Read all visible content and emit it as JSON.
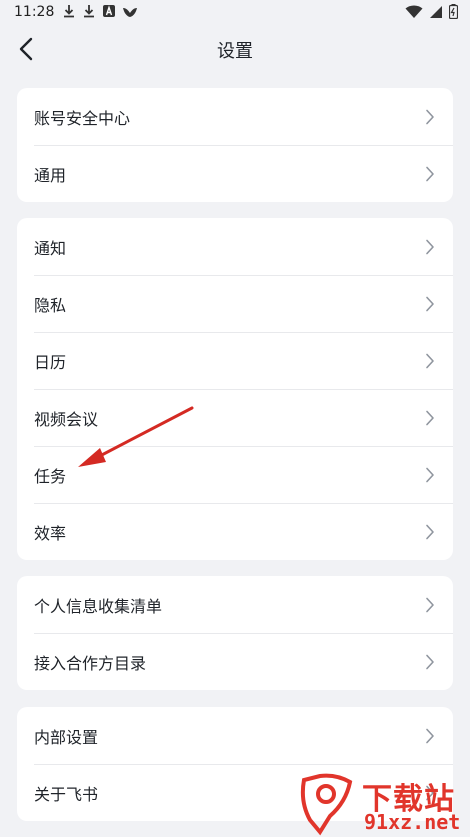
{
  "status_bar": {
    "time": "11:28",
    "left_icons": [
      "download-icon",
      "download-icon",
      "a-badge-icon",
      "bird-icon"
    ],
    "right_icons": [
      "wifi-icon",
      "signal-icon",
      "battery-icon"
    ]
  },
  "header": {
    "title": "设置"
  },
  "groups": [
    {
      "items": [
        {
          "label": "账号安全中心"
        },
        {
          "label": "通用"
        }
      ]
    },
    {
      "items": [
        {
          "label": "通知"
        },
        {
          "label": "隐私"
        },
        {
          "label": "日历"
        },
        {
          "label": "视频会议"
        },
        {
          "label": "任务"
        },
        {
          "label": "效率"
        }
      ]
    },
    {
      "items": [
        {
          "label": "个人信息收集清单"
        },
        {
          "label": "接入合作方目录"
        }
      ]
    },
    {
      "items": [
        {
          "label": "内部设置"
        },
        {
          "label": "关于飞书"
        }
      ]
    }
  ],
  "watermark": {
    "text_cn": "下载站",
    "text_url": "91xz.net"
  },
  "colors": {
    "background": "#f1f2f5",
    "card": "#ffffff",
    "annotation_arrow": "#d42a23",
    "watermark": "#e1352b"
  }
}
